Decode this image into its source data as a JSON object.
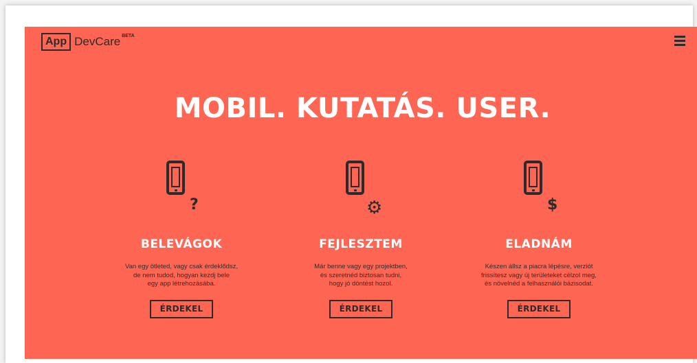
{
  "logo": {
    "box": "App",
    "name": "DevCare",
    "badge": "BETA"
  },
  "headline": "MOBIL. KUTATÁS. USER.",
  "columns": [
    {
      "title": "BELEVÁGOK",
      "icon": "phone-question-icon",
      "badge": "?",
      "desc": [
        "Van egy ötleted, vagy csak érdeklődsz,",
        "de nem tudod, hogyan kezdj bele",
        "egy app létrehozásába."
      ],
      "button": "ÉRDEKEL"
    },
    {
      "title": "FEJLESZTEM",
      "icon": "phone-gear-icon",
      "badge": "⚙",
      "desc": [
        "Már benne vagy egy projektben,",
        "és szeretnéd biztosan tudni,",
        "hogy jó döntést hozol."
      ],
      "button": "ÉRDEKEL"
    },
    {
      "title": "ELADNÁM",
      "icon": "phone-dollar-icon",
      "badge": "$",
      "desc": [
        "Készen állsz a piacra lépésre, verziót",
        "frissítesz vagy új területeket célzol meg,",
        "és növelnéd a felhasználói bázisodat."
      ],
      "button": "ÉRDEKEL"
    }
  ],
  "colors": {
    "hero_bg": "#fe6553",
    "dark": "#2b2b2b",
    "text_light": "#ffffff"
  }
}
